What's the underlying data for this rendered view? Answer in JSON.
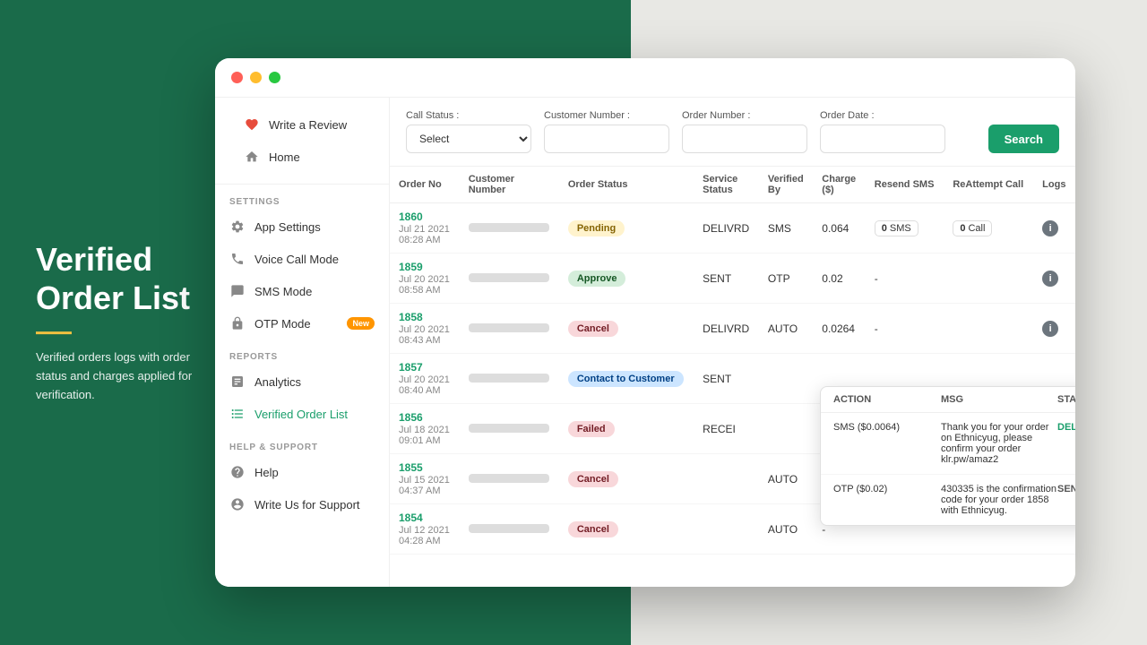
{
  "background": {
    "left_color": "#1a6b4a",
    "right_color": "#e8e8e4"
  },
  "hero": {
    "title": "Verified Order List",
    "divider_color": "#f0c040",
    "description": "Verified orders logs with order status and charges applied for verification."
  },
  "window": {
    "dots": [
      "#ff5f57",
      "#ffbd2e",
      "#28c840"
    ]
  },
  "sidebar": {
    "top_items": [
      {
        "label": "Write a Review",
        "icon": "heart-icon"
      },
      {
        "label": "Home",
        "icon": "home-icon"
      }
    ],
    "settings_label": "SETTINGS",
    "settings_items": [
      {
        "label": "App Settings",
        "icon": "gear-icon"
      },
      {
        "label": "Voice Call Mode",
        "icon": "phone-icon"
      },
      {
        "label": "SMS Mode",
        "icon": "sms-icon"
      },
      {
        "label": "OTP Mode",
        "icon": "lock-icon",
        "badge": "New"
      }
    ],
    "reports_label": "REPORTS",
    "reports_items": [
      {
        "label": "Analytics",
        "icon": "chart-icon",
        "active": false
      },
      {
        "label": "Verified Order List",
        "icon": "list-icon",
        "active": true
      }
    ],
    "help_label": "HELP & SUPPORT",
    "help_items": [
      {
        "label": "Help",
        "icon": "question-icon"
      },
      {
        "label": "Write Us for Support",
        "icon": "support-icon"
      }
    ]
  },
  "filters": {
    "call_status_label": "Call Status :",
    "call_status_placeholder": "Select",
    "customer_number_label": "Customer Number :",
    "customer_number_placeholder": "",
    "order_number_label": "Order Number :",
    "order_number_placeholder": "",
    "order_date_label": "Order Date :",
    "order_date_placeholder": "",
    "search_button": "Search"
  },
  "table": {
    "columns": [
      "Order No",
      "Customer Number",
      "Order Status",
      "Service Status",
      "Verified By",
      "Charge ($)",
      "Resend SMS",
      "ReAttempt Call",
      "Logs"
    ],
    "rows": [
      {
        "order_no": "1860",
        "order_date": "Jul 21 2021 08:28 AM",
        "customer": "blurred",
        "order_status": "Pending",
        "service_status": "DELIVRD",
        "verified_by": "SMS",
        "charge": "0.064",
        "resend_sms": "0 SMS",
        "reattempt_call": "0 Call",
        "logs": true,
        "has_info": true
      },
      {
        "order_no": "1859",
        "order_date": "Jul 20 2021 08:58 AM",
        "customer": "blurred",
        "order_status": "Approve",
        "service_status": "SENT",
        "verified_by": "OTP",
        "charge": "0.02",
        "resend_sms": "-",
        "reattempt_call": "",
        "logs": false,
        "has_info": true
      },
      {
        "order_no": "1858",
        "order_date": "Jul 20 2021 08:43 AM",
        "customer": "blurred",
        "order_status": "Cancel",
        "service_status": "DELIVRD",
        "verified_by": "AUTO",
        "charge": "0.0264",
        "resend_sms": "-",
        "reattempt_call": "",
        "logs": false,
        "has_info": true,
        "tooltip": true
      },
      {
        "order_no": "1857",
        "order_date": "Jul 20 2021 08:40 AM",
        "customer": "blurred",
        "order_status": "Contact to Customer",
        "service_status": "SENT",
        "verified_by": "",
        "charge": "",
        "resend_sms": "",
        "reattempt_call": "",
        "logs": false,
        "has_info": false
      },
      {
        "order_no": "1856",
        "order_date": "Jul 18 2021 09:01 AM",
        "customer": "blurred",
        "order_status": "Failed",
        "service_status": "RECEI",
        "verified_by": "",
        "charge": "",
        "resend_sms": "",
        "reattempt_call": "",
        "logs": false,
        "has_info": false
      },
      {
        "order_no": "1855",
        "order_date": "Jul 15 2021 04:37 AM",
        "customer": "blurred",
        "order_status": "Cancel",
        "service_status": "",
        "verified_by": "AUTO",
        "charge": "-",
        "resend_sms": "",
        "reattempt_call": "",
        "logs": false,
        "has_info": false
      },
      {
        "order_no": "1854",
        "order_date": "Jul 12 2021 04:28 AM",
        "customer": "blurred",
        "order_status": "Cancel",
        "service_status": "",
        "verified_by": "AUTO",
        "charge": "-",
        "resend_sms": "",
        "reattempt_call": "",
        "logs": false,
        "has_info": false
      }
    ]
  },
  "tooltip": {
    "col_action": "ACTION",
    "col_msg": "MSG",
    "col_status": "STATUS",
    "rows": [
      {
        "action": "SMS ($0.0064)",
        "msg": "Thank you for your order on Ethnicyug, please confirm your order klr.pw/amaz2",
        "status": "DELIVRD"
      },
      {
        "action": "OTP ($0.02)",
        "msg": "430335 is the confirmation code for your order 1858 with Ethnicyug.",
        "status": "SENT"
      }
    ]
  }
}
